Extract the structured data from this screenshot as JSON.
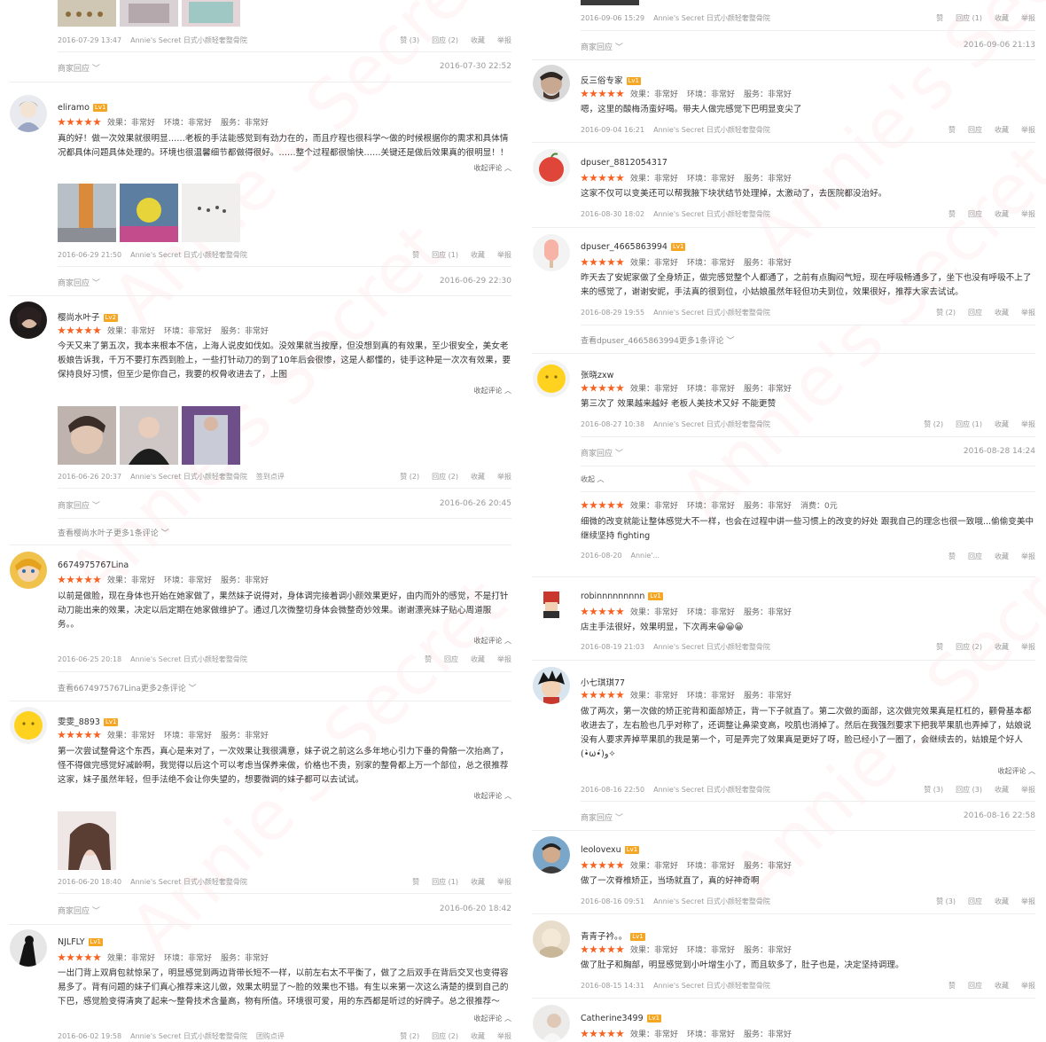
{
  "common": {
    "rating_effect": "效果：非常好",
    "rating_env": "环境：非常好",
    "rating_service": "服务：非常好",
    "shop": "Annie's Secret 日式小颜轻奢整骨院",
    "like": "赞",
    "reply": "回应",
    "fav": "收藏",
    "report": "举报",
    "collapse": "收起评论 ︿",
    "merchant_reply": "商家回应 ﹀",
    "level_badges": {
      "lv1": "Lv1",
      "lv2": "Lv2"
    },
    "watermark": "Annie's Secret"
  },
  "left": {
    "top": {
      "meta_date": "2016-07-29 13:47",
      "like_label": "赞 (3)",
      "reply_label": "回应 (2)",
      "merchant_date": "2016-07-30 22:52"
    },
    "r1": {
      "name": "eliramo",
      "text": "真的好！做一次效果就很明显……老板的手法能感觉到有劲力在的，而且疗程也很科学～做的时候根据你的需求和具体情况都具体问题具体处理的。环境也很温馨细节都做得很好。……整个过程都很愉快……关键还是做后效果真的很明显！！",
      "meta_date": "2016-06-29 21:50",
      "reply_label": "回应 (1)",
      "merchant_date": "2016-06-29 22:30"
    },
    "r2": {
      "name": "樱尚水叶子",
      "text": "今天又来了第五次，我本来根本不信，上海人说皮如伐如。没效果就当按摩，但没想到真的有效果，至少很安全，美女老板娘告诉我，千万不要打东西到脸上，一些打针动刀的到了10年后会很惨，这是人都懂的，徒手这种是一次次有效果，要保持良好习惯，但至少是你自己，我要的权骨收进去了，上图",
      "meta_date": "2016-06-26 20:37",
      "extra_tag": "签到点评",
      "like_label": "赞 (2)",
      "reply_label": "回应 (2)",
      "merchant_date": "2016-06-26 20:45",
      "more": "查看樱尚水叶子更多1条评论 ﹀"
    },
    "r3": {
      "name": "6674975767Lina",
      "text": "以前是做脸，现在身体也开始在她家做了，果然妹子说得对，身体调完接着调小颜效果更好，由内而外的感觉，不是打针动刀能出来的效果，决定以后定期在她家做维护了。通过几次微整切身体会微整奇妙效果。谢谢漂亮妹子贴心周道服务。。",
      "meta_date": "2016-06-25 20:18",
      "more": "查看6674975767Lina更多2条评论 ﹀"
    },
    "r4": {
      "name": "雯雯_8893",
      "text": "第一次尝试整骨这个东西，真心是来对了，一次效果让我很满意，妹子说之前这么多年地心引力下垂的骨骼一次抬高了，怪不得做完感觉好减龄啊，我觉得以后这个可以考虑当保养来做，价格也不贵，别家的整骨都上万一个部位，总之很推荐这家，妹子虽然年轻，但手法绝不会让你失望的，想要微调的妹子都可以去试试。",
      "meta_date": "2016-06-20 18:40",
      "reply_label": "回应 (1)",
      "merchant_date": "2016-06-20 18:42"
    },
    "r5": {
      "name": "NJLFLY",
      "text": "一出门背上双肩包就惊呆了，明显感觉到两边背带长短不一样，以前左右太不平衡了，做了之后双手在背后交叉也变得容易多了。背有问题的妹子们真心推荐来这儿做，效果太明显了～脸的效果也不错。有生以来第一次这么清楚的摸到自己的下巴，感觉脸变得清爽了起来～整骨技术含量高，物有所值。环境很可爱，用的东西都是听过的好牌子。总之很推荐～",
      "meta_date": "2016-06-02 19:58",
      "extra_tag": "团购点评",
      "like_label": "赞 (2)",
      "reply_label": "回应 (2)"
    }
  },
  "right": {
    "top": {
      "meta_date": "2016-09-06 15:29",
      "reply_label": "回应 (1)",
      "merchant_date": "2016-09-06 21:13"
    },
    "r1": {
      "name": "反三俗专家",
      "text": "嗯，这里的酸梅汤蛮好喝。带夫人做完感觉下巴明显变尖了",
      "meta_date": "2016-09-04 16:21"
    },
    "r2": {
      "name": "dpuser_8812054317",
      "text": "这家不仅可以变美还可以帮我腋下块状结节处理掉，太激动了，去医院都没治好。",
      "meta_date": "2016-08-30 18:02"
    },
    "r3": {
      "name": "dpuser_4665863994",
      "text": "昨天去了安妮家做了全身矫正，做完感觉整个人都通了，之前有点胸闷气短，现在呼吸畅通多了，坐下也没有呼吸不上了来的感觉了，谢谢安妮，手法真的很到位，小姑娘虽然年轻但功夫到位，效果很好，推荐大家去试试。",
      "meta_date": "2016-08-29 19:55",
      "like_label": "赞 (2)",
      "more": "查看dpuser_4665863994更多1条评论 ﹀"
    },
    "r4": {
      "name": "张晓zxw",
      "text": "第三次了 效果越来越好 老板人美技术又好 不能更赞",
      "meta_date": "2016-08-27 10:38",
      "like_label": "赞 (2)",
      "reply_label": "回应 (1)",
      "merchant_date": "2016-08-28 14:24",
      "collapse_label": "收起 ︿",
      "sub_rating_cost": "消费：0元",
      "sub_text": "细微的改变就能让整体感觉大不一样，也会在过程中讲一些习惯上的改变的好处 跟我自己的理念也很一致哦...偷偷变美中 继续坚持 fighting",
      "sub_meta_date": "2016-08-20",
      "sub_shop": "Annie'..."
    },
    "r5": {
      "name": "robinnnnnnnnn",
      "text": "店主手法很好，效果明显，下次再来😀😀😀",
      "meta_date": "2016-08-19 21:03",
      "reply_label": "回应 (2)"
    },
    "r6": {
      "name": "小七琪琪77",
      "text": "做了两次，第一次做的矫正驼背和面部矫正，背一下子就直了。第二次做的面部，这次做完效果真是杠杠的，颧骨基本都收进去了，左右脸也几乎对称了，还调整让鼻梁变高，咬肌也消掉了。然后在我强烈要求下把我苹果肌也弄掉了，姑娘说没有人要求弄掉苹果肌的我是第一个，可是弄完了效果真是更好了呀，脸已经小了一圈了，会继续去的，姑娘是个好人 (•̀ω•́)و✧",
      "meta_date": "2016-08-16 22:50",
      "like_label": "赞 (3)",
      "reply_label": "回应 (3)",
      "merchant_date": "2016-08-16 22:58"
    },
    "r7": {
      "name": "leolovexu",
      "text": "做了一次脊椎矫正，当场就直了，真的好神奇啊",
      "meta_date": "2016-08-16 09:51",
      "like_label": "赞 (3)"
    },
    "r8": {
      "name": "青青子衿。。",
      "text": "做了肚子和胸部，明显感觉到小叶增生小了，而且软多了，肚子也是，决定坚持调理。",
      "meta_date": "2016-08-15 14:31"
    },
    "r9": {
      "name": "Catherine3499"
    }
  }
}
